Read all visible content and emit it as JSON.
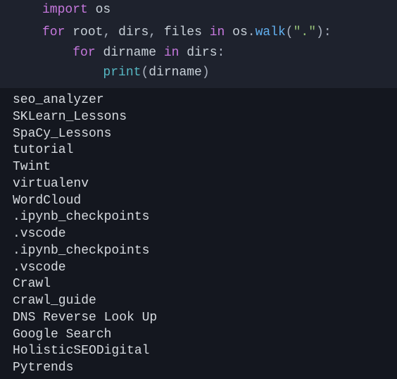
{
  "code": {
    "line1": {
      "import_kw": "import",
      "module": "os"
    },
    "line2_blank": "",
    "line3": {
      "for_kw": "for",
      "root_var": "root",
      "comma1": ",",
      "dirs_var": "dirs",
      "comma2": ",",
      "files_var": "files",
      "in_kw": "in",
      "os_var": "os",
      "dot": ".",
      "walk_fn": "walk",
      "lparen": "(",
      "str_lit": "\".\"",
      "rparen": ")",
      "colon": ":"
    },
    "line4": {
      "for_kw": "for",
      "dirname_var": "dirname",
      "in_kw": "in",
      "dirs_var": "dirs",
      "colon": ":"
    },
    "line5": {
      "print_fn": "print",
      "lparen": "(",
      "dirname_var": "dirname",
      "rparen": ")"
    }
  },
  "output": [
    "seo_analyzer",
    "SKLearn_Lessons",
    "SpaCy_Lessons",
    "tutorial",
    "Twint",
    "virtualenv",
    "WordCloud",
    ".ipynb_checkpoints",
    ".vscode",
    ".ipynb_checkpoints",
    ".vscode",
    "Crawl",
    "crawl_guide",
    "DNS Reverse Look Up",
    "Google Search",
    "HolisticSEODigital",
    "Pytrends"
  ]
}
